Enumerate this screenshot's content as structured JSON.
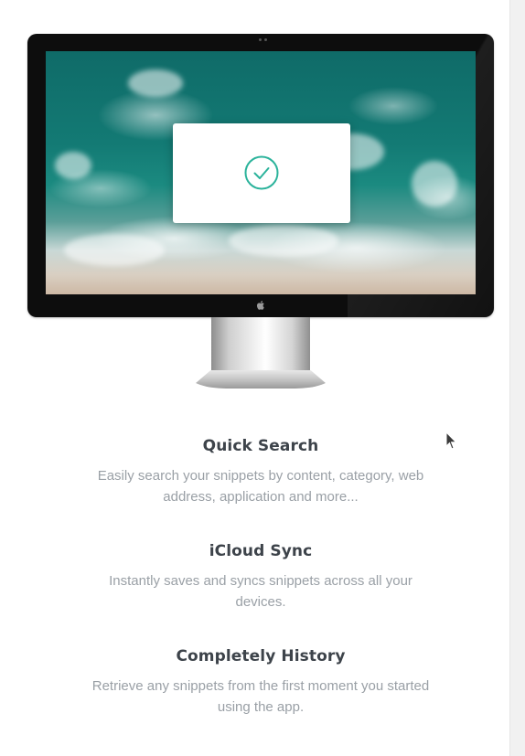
{
  "features": [
    {
      "title": "Quick Search",
      "description": "Easily search your snippets by content, category, web address, application and more..."
    },
    {
      "title": "iCloud Sync",
      "description": "Instantly saves and syncs snippets across all your devices."
    },
    {
      "title": "Completely History",
      "description": "Retrieve any snippets from the first moment you started using the app."
    }
  ],
  "icons": {
    "dialog": "check-circle-icon",
    "monitor_logo": "apple-logo-icon",
    "pointer": "mouse-cursor-icon"
  },
  "colors": {
    "accent": "#2bb39b",
    "title_text": "#3d434a",
    "body_text": "#9aa0a6",
    "background": "#ffffff"
  }
}
